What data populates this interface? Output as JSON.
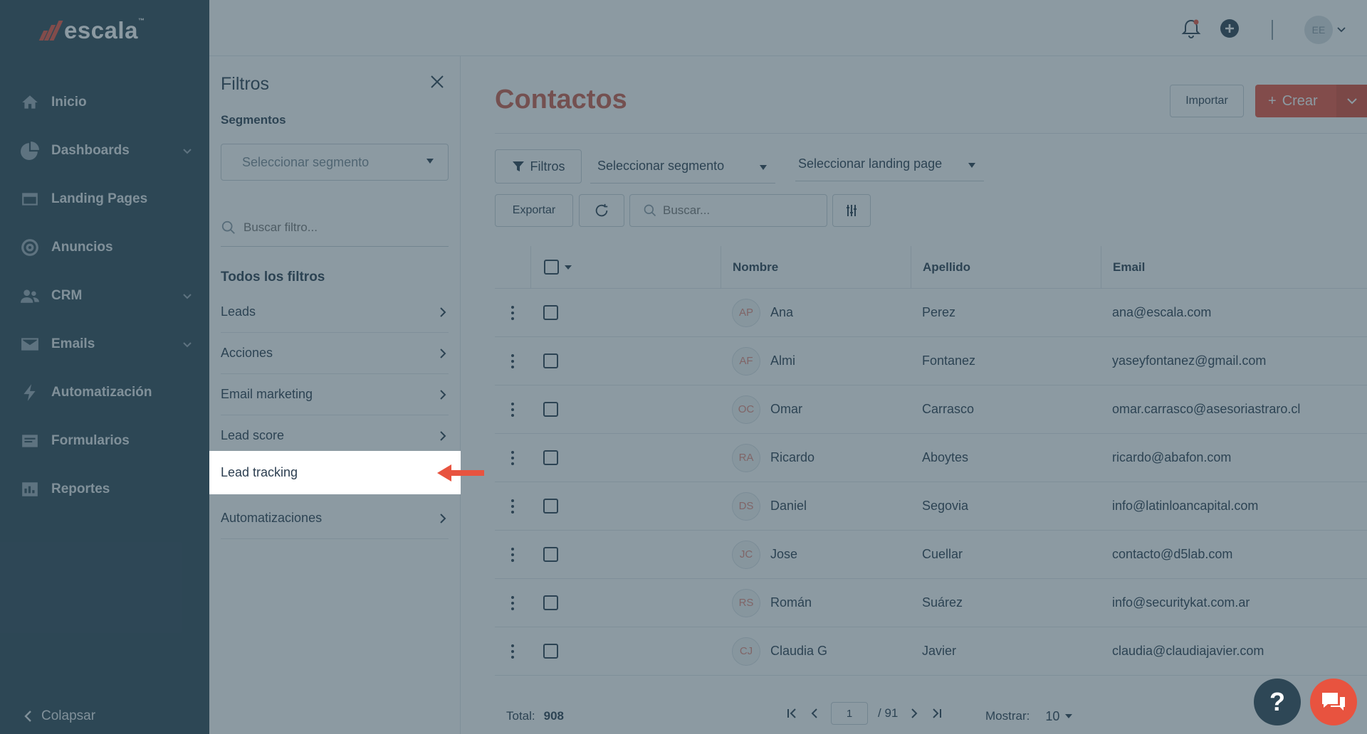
{
  "brand": {
    "name": "escala",
    "tm": "™"
  },
  "sidebar": {
    "items": [
      {
        "label": "Inicio",
        "icon": "home-icon",
        "has_chevron": false
      },
      {
        "label": "Dashboards",
        "icon": "pie-chart-icon",
        "has_chevron": true
      },
      {
        "label": "Landing Pages",
        "icon": "browser-icon",
        "has_chevron": false
      },
      {
        "label": "Anuncios",
        "icon": "target-icon",
        "has_chevron": false
      },
      {
        "label": "CRM",
        "icon": "users-icon",
        "has_chevron": true
      },
      {
        "label": "Emails",
        "icon": "mail-icon",
        "has_chevron": true
      },
      {
        "label": "Automatización",
        "icon": "lightning-icon",
        "has_chevron": false
      },
      {
        "label": "Formularios",
        "icon": "form-icon",
        "has_chevron": false
      },
      {
        "label": "Reportes",
        "icon": "bar-chart-icon",
        "has_chevron": false
      }
    ],
    "collapse_label": "Colapsar"
  },
  "topbar": {
    "avatar_initials": "EE"
  },
  "filters_panel": {
    "title": "Filtros",
    "segments_label": "Segmentos",
    "segment_select": "Seleccionar segmento",
    "search_placeholder": "Buscar filtro...",
    "all_filters_label": "Todos los filtros",
    "items": [
      "Leads",
      "Acciones",
      "Email marketing",
      "Lead score",
      "Lead tracking",
      "Automatizaciones"
    ],
    "highlighted_item": "Lead tracking"
  },
  "contacts": {
    "title": "Contactos",
    "import_label": "Importar",
    "create_label": "Crear",
    "filters_button": "Filtros",
    "segment_select": "Seleccionar segmento",
    "landing_select": "Seleccionar landing page",
    "export_label": "Exportar",
    "search_placeholder": "Buscar...",
    "columns": [
      "Nombre",
      "Apellido",
      "Email"
    ],
    "rows": [
      {
        "initials": "AP",
        "first": "Ana",
        "last": "Perez",
        "email": "ana@escala.com"
      },
      {
        "initials": "AF",
        "first": "Almi",
        "last": "Fontanez",
        "email": "yaseyfontanez@gmail.com"
      },
      {
        "initials": "OC",
        "first": "Omar",
        "last": "Carrasco",
        "email": "omar.carrasco@asesoriastraro.cl"
      },
      {
        "initials": "RA",
        "first": "Ricardo",
        "last": "Aboytes",
        "email": "ricardo@abafon.com"
      },
      {
        "initials": "DS",
        "first": "Daniel",
        "last": "Segovia",
        "email": "info@latinloancapital.com"
      },
      {
        "initials": "JC",
        "first": "Jose",
        "last": "Cuellar",
        "email": "contacto@d5lab.com"
      },
      {
        "initials": "RS",
        "first": "Román",
        "last": "Suárez",
        "email": "info@securitykat.com.ar"
      },
      {
        "initials": "CJ",
        "first": "Claudia G",
        "last": "Javier",
        "email": "claudia@claudiajavier.com"
      }
    ],
    "footer": {
      "total_label": "Total:",
      "total_value": "908",
      "page": "1",
      "page_total": "/ 91",
      "show_label": "Mostrar:",
      "show_value": "10"
    }
  },
  "help_label": "?",
  "colors": {
    "sidebar": "#2e4756",
    "accent": "#e8533f",
    "title": "#c95c4b"
  }
}
